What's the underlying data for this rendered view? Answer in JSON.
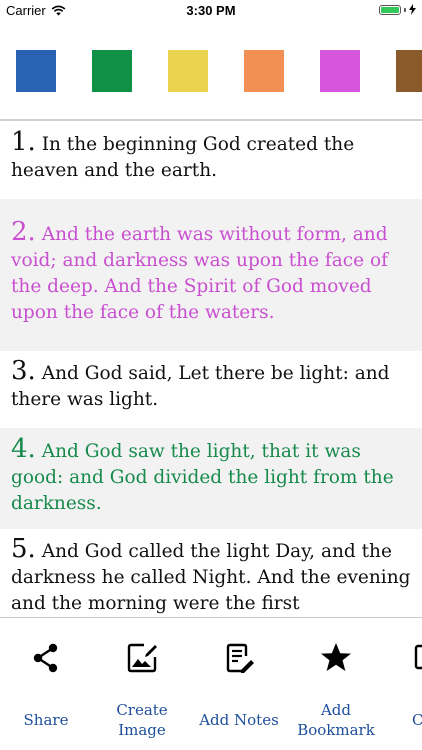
{
  "status_bar": {
    "carrier": "Carrier",
    "time": "3:30 PM",
    "battery_color": "#34c759"
  },
  "color_swatches": [
    {
      "name": "blue",
      "color": "#2962b3"
    },
    {
      "name": "green",
      "color": "#0f9248"
    },
    {
      "name": "yellow",
      "color": "#ead44f"
    },
    {
      "name": "orange",
      "color": "#f19052"
    },
    {
      "name": "magenta",
      "color": "#d655dd"
    },
    {
      "name": "brown",
      "color": "#8b5a2b"
    }
  ],
  "verses": [
    {
      "num": "1.",
      "text": "In the beginning God created the heaven and the earth.",
      "color": "#111111",
      "bg": "#ffffff"
    },
    {
      "num": "2.",
      "text": "And the earth was without form, and void; and darkness was upon the face of the deep. And the Spirit of God moved upon the face of the waters.",
      "color": "#c94fd0",
      "bg": "#f2f2f2"
    },
    {
      "num": "3.",
      "text": "And God said, Let there be light: and there was light.",
      "color": "#111111",
      "bg": "#ffffff"
    },
    {
      "num": "4.",
      "text": "And God saw the light, that it was good: and God divided the light from the darkness.",
      "color": "#178a4c",
      "bg": "#f2f2f2"
    },
    {
      "num": "5.",
      "text": "And God called the light Day, and the darkness he called Night. And the evening and the morning were the first",
      "color": "#111111",
      "bg": "#ffffff"
    }
  ],
  "toolbar": {
    "share": "Share",
    "create_image_line1": "Create",
    "create_image_line2": "Image",
    "add_notes": "Add Notes",
    "add_bookmark_line1": "Add",
    "add_bookmark_line2": "Bookmark",
    "copy_partial": "C",
    "label_color": "#1e4f9c"
  }
}
